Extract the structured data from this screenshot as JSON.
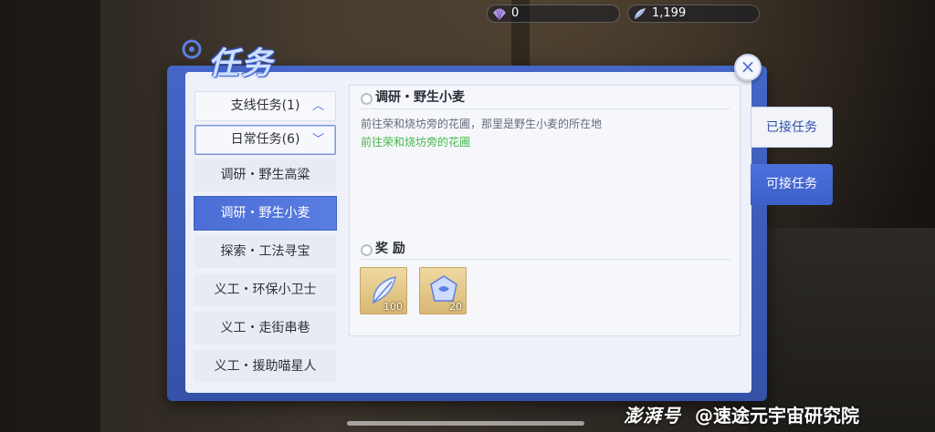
{
  "currency": [
    {
      "icon": "shell-icon",
      "value": "0"
    },
    {
      "icon": "feather-icon",
      "value": "1,199"
    }
  ],
  "title": "任务",
  "close_label": "×",
  "categories": [
    {
      "label": "支线任务(1)",
      "chevron": "up"
    },
    {
      "label": "日常任务(6)",
      "chevron": "down"
    }
  ],
  "quests": [
    "调研・野生高粱",
    "调研・野生小麦",
    "探索・工法寻宝",
    "义工・环保小卫士",
    "义工・走街串巷",
    "义工・援助喵星人"
  ],
  "selected_quest_index": 1,
  "detail": {
    "title": "调研・野生小麦",
    "description": "前往荣和烧坊旁的花圃，那里是野生小麦的所在地",
    "target": "前往荣和烧坊旁的花圃",
    "rewards_title": "奖 励",
    "rewards": [
      {
        "icon": "feather-icon",
        "count": "100"
      },
      {
        "icon": "crystal-icon",
        "count": "20"
      }
    ]
  },
  "tabs": {
    "accepted": "已接任务",
    "available": "可接任务"
  },
  "watermark": {
    "brand": "澎湃号",
    "text": "@速途元宇宙研究院"
  },
  "colors": {
    "accent": "#4a6fd8",
    "target_green": "#44b84a",
    "reward_gold": "#d8b774"
  }
}
